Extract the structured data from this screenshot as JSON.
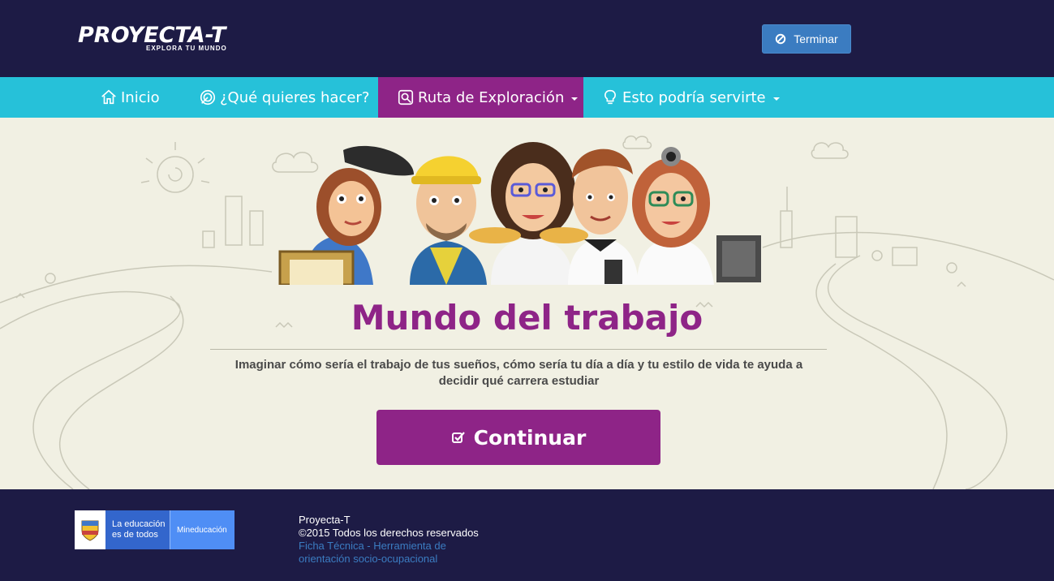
{
  "header": {
    "logo_text": "PROYECTA-T",
    "logo_tagline": "EXPLORA TU MUNDO",
    "end_button_label": "Terminar"
  },
  "nav": {
    "items": [
      {
        "label": "Inicio",
        "icon": "home-icon",
        "active": false,
        "dropdown": false
      },
      {
        "label": "¿Qué quieres hacer?",
        "icon": "target-icon",
        "active": false,
        "dropdown": false
      },
      {
        "label": "Ruta de Exploración",
        "icon": "route-icon",
        "active": true,
        "dropdown": true
      },
      {
        "label": "Esto podría servirte",
        "icon": "lightbulb-icon",
        "active": false,
        "dropdown": true
      }
    ]
  },
  "main": {
    "title": "Mundo del trabajo",
    "description": "Imaginar cómo sería el trabajo de tus sueños, cómo sería tu día a día y tu estilo de vida te ayuda a decidir qué carrera estudiar",
    "cta_label": "Continuar"
  },
  "footer": {
    "gov_logo_left": "La educación es de todos",
    "gov_logo_right": "Mineducación",
    "site_name": "Proyecta-T",
    "copyright": "©2015 Todos los derechos reservados",
    "link_label": "Ficha Técnica - Herramienta de orientación socio-ocupacional"
  },
  "colors": {
    "dark_navy": "#1d1b45",
    "nav_cyan": "#26c1d9",
    "accent_purple": "#8e2487",
    "button_blue": "#3b7cc1",
    "background_cream": "#f1f0e3"
  }
}
